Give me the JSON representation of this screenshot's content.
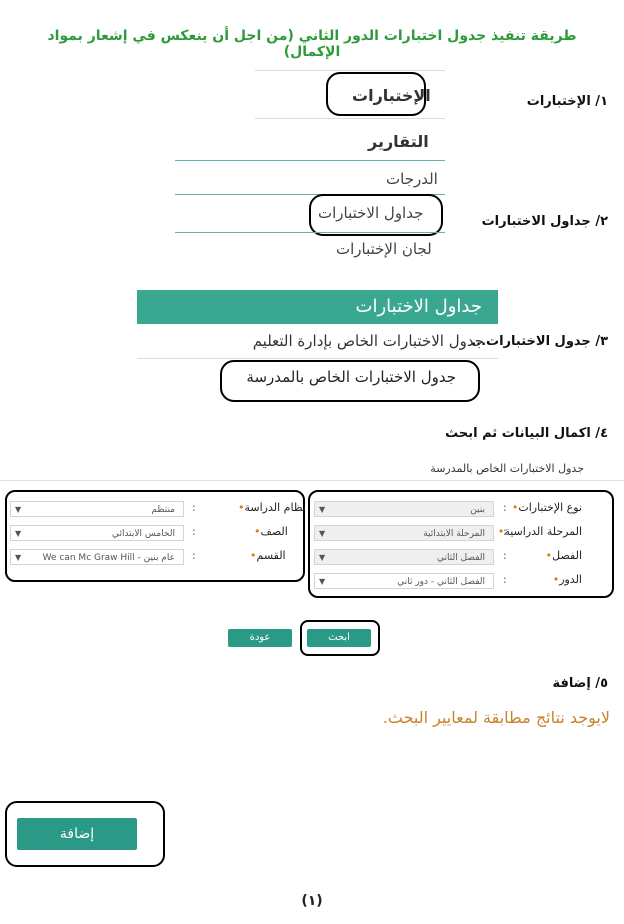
{
  "title": "طريقة تنفيذ جدول اختبارات الدور الثاني (من اجل أن ينعكس في إشعار بمواد الإكمال)",
  "steps": {
    "s1": "١/ الإختبارات",
    "s2": "٢/ جداول الاختبارات",
    "s3": "٣/ جدول الاختبارات...",
    "s4": "٤/ اكمال البيانات ثم ابحث",
    "s5": "٥/ إضافة"
  },
  "menu": {
    "tests": "الإختبارات",
    "reports": "التقارير",
    "grades": "الدرجات",
    "test_tables": "جداول الاختبارات",
    "test_committees": "لجان الإختبارات"
  },
  "submenu": {
    "header": "جداول الاختبارات",
    "education_admin": "جدول الاختبارات الخاص بإدارة التعليم",
    "school": "جدول الاختبارات الخاص بالمدرسة"
  },
  "form": {
    "title": "جدول الاختبارات الخاص بالمدرسة",
    "right": [
      {
        "label": "نوع الإختبارات",
        "value": "بنين"
      },
      {
        "label": "المرحلة الدراسية",
        "value": "المرحلة الابتدائية"
      },
      {
        "label": "الفصل",
        "value": "الفصل الثاني"
      },
      {
        "label": "الدور",
        "value": "الفصل الثاني - دور ثاني"
      }
    ],
    "left": [
      {
        "label": "نظام الدراسة",
        "value": "منتظم"
      },
      {
        "label": "الصف",
        "value": "الخامس الابتدائي"
      },
      {
        "label": "القسم",
        "value": "عام بنين - We can Mc Graw Hill"
      }
    ],
    "search": "ابحث",
    "back": "عودة"
  },
  "no_results": "لايوجد نتائج مطابقة لمعايير البحث.",
  "add": "إضافة",
  "page_number": "(١)"
}
